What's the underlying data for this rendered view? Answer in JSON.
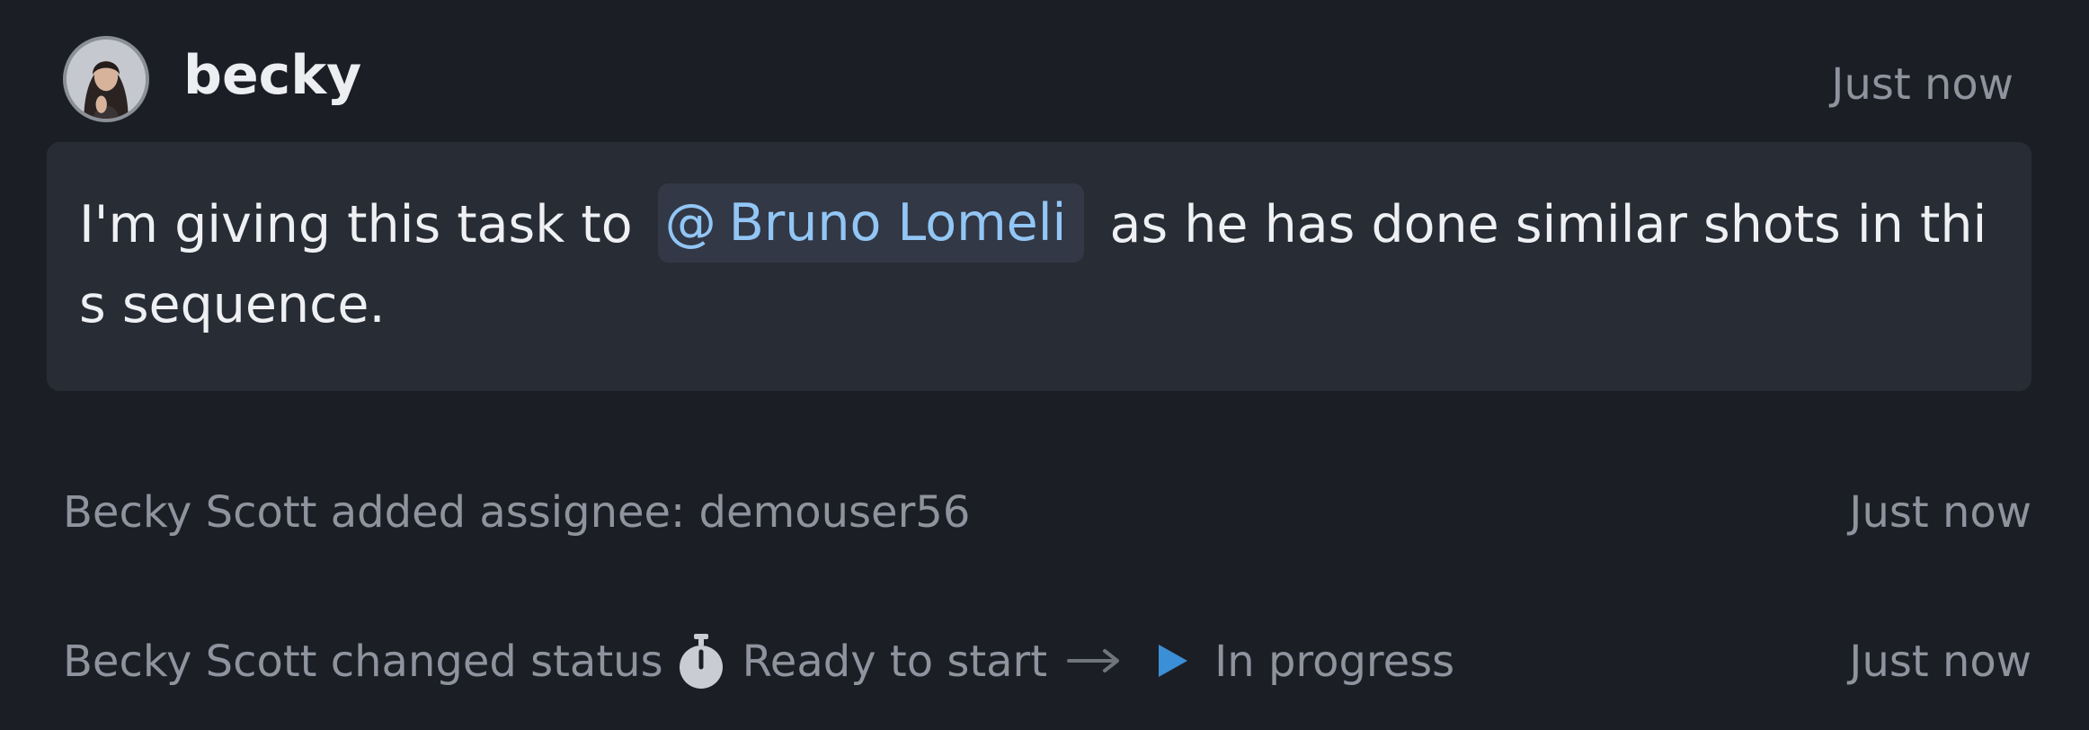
{
  "comment": {
    "author": "becky",
    "time": "Just now",
    "text_before": "I'm giving this task to",
    "mention": {
      "icon": "at-icon",
      "symbol": "@",
      "name": "Bruno Lomeli"
    },
    "text_after": "as he has done similar shots in this sequence."
  },
  "activity": [
    {
      "text": "Becky Scott added assignee: demouser56",
      "time": "Just now"
    },
    {
      "prefix": "Becky Scott changed status",
      "from_icon": "stopwatch-icon",
      "from_status": "Ready to start",
      "arrow_icon": "arrow-right-icon",
      "to_icon": "play-icon",
      "to_status": "In progress",
      "time": "Just now"
    }
  ],
  "colors": {
    "background": "#1c1e26",
    "comment_body": "#282c35",
    "mention_bg": "#323846",
    "mention_text": "#92c6f5",
    "muted_text": "#8e939d",
    "in_progress_accent": "#3b8fd6"
  }
}
